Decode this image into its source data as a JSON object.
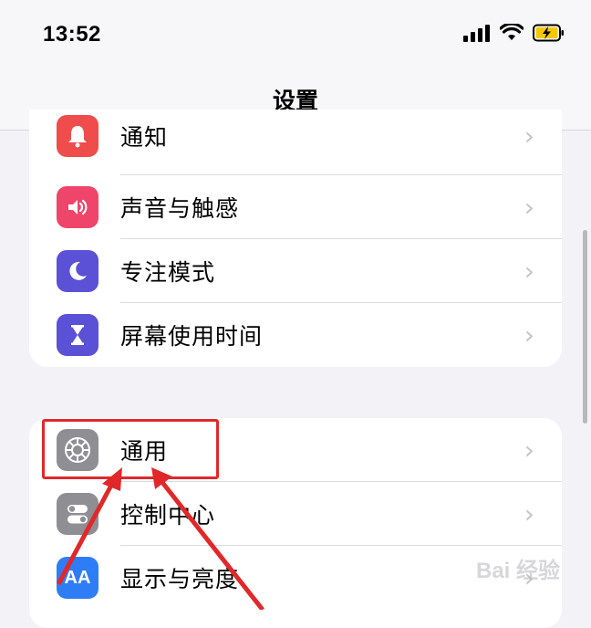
{
  "status": {
    "time": "13:52"
  },
  "nav": {
    "title": "设置"
  },
  "groups": [
    {
      "items": [
        {
          "label": "通知",
          "icon": "bell-icon",
          "color": "#ef4c4c"
        },
        {
          "label": "声音与触感",
          "icon": "speaker-icon",
          "color": "#f0456b"
        },
        {
          "label": "专注模式",
          "icon": "moon-icon",
          "color": "#5b51d6"
        },
        {
          "label": "屏幕使用时间",
          "icon": "hourglass-icon",
          "color": "#5b51d6"
        }
      ]
    },
    {
      "items": [
        {
          "label": "通用",
          "icon": "gear-icon",
          "color": "#8e8e93"
        },
        {
          "label": "控制中心",
          "icon": "toggle-icon",
          "color": "#8e8e93"
        },
        {
          "label": "显示与亮度",
          "icon": "display-aa-icon",
          "color": "#2f7df6",
          "icon_text": "AA"
        }
      ]
    }
  ],
  "watermark": "Bai 经验",
  "colors": {
    "highlight": "#e0282a",
    "arrow": "#e0282a"
  }
}
